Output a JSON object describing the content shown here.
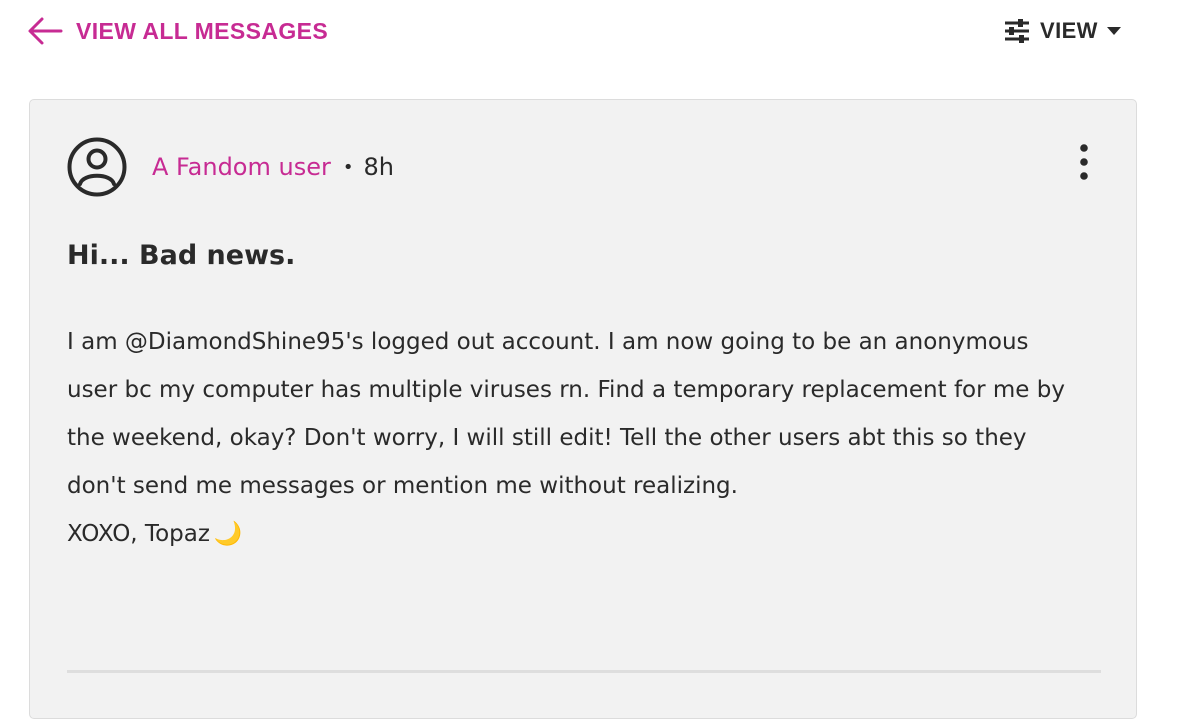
{
  "header": {
    "back_label": "VIEW ALL MESSAGES",
    "view_label": "VIEW"
  },
  "post": {
    "author": "A Fandom user",
    "separator": "•",
    "time_ago": "8h",
    "title": "Hi... Bad news.",
    "body_paragraph": "I am @DiamondShine95's logged out account. I am now going to be an anonymous user bc my computer has multiple viruses rn. Find a temporary replacement for me by the weekend, okay? Don't worry, I will still edit! Tell the other users abt this so they don't send me messages or mention me without realizing.",
    "signoff": "XOXO, Topaz",
    "signoff_emoji": "🌙"
  },
  "colors": {
    "accent": "#c72b93",
    "text": "#2a2a2a",
    "card_bg": "#f2f2f2"
  },
  "icons": [
    "arrow-left-icon",
    "sliders-icon",
    "caret-down-icon",
    "user-avatar-icon",
    "more-vertical-icon",
    "crescent-moon-icon"
  ]
}
